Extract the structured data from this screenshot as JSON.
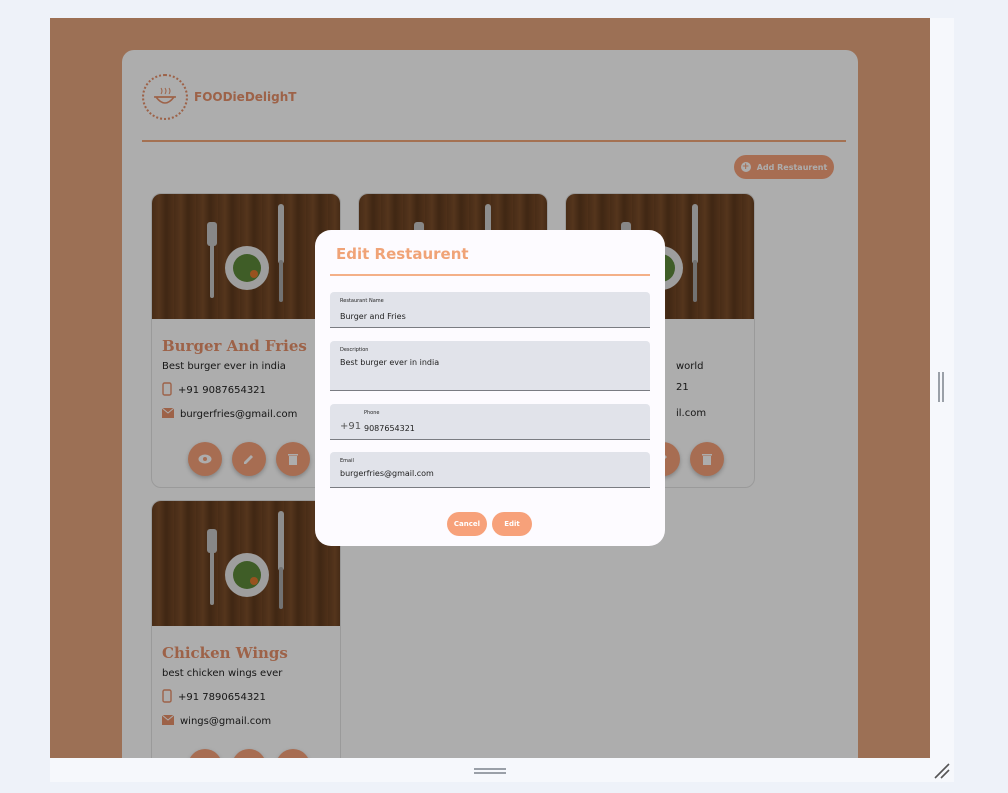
{
  "brand": {
    "name": "FOODieDelighT",
    "logo_text": "FOODieDelighT"
  },
  "toolbar": {
    "add_label": "Add Restaurent"
  },
  "restaurants": [
    {
      "name": "Burger And Fries",
      "description": "Best burger ever in india",
      "phone": "+91 9087654321",
      "email": "burgerfries@gmail.com"
    },
    {
      "name": "",
      "description": "",
      "phone": "",
      "email": ""
    },
    {
      "name": "",
      "description": "world",
      "phone": "21",
      "email": "il.com"
    },
    {
      "name": "Chicken Wings",
      "description": "best chicken wings ever",
      "phone": "+91 7890654321",
      "email": "wings@gmail.com"
    }
  ],
  "modal": {
    "title": "Edit Restaurent",
    "fields": {
      "name": {
        "label": "Restaurant Name",
        "value": "Burger and Fries"
      },
      "description": {
        "label": "Description",
        "value": "Best burger ever in india"
      },
      "phone": {
        "label": "Phone",
        "prefix": "+91",
        "value": "9087654321"
      },
      "email": {
        "label": "Email",
        "value": "burgerfries@gmail.com"
      }
    },
    "cancel_label": "Cancel",
    "edit_label": "Edit"
  },
  "colors": {
    "accent": "#f7a17a",
    "background": "#e6a57e",
    "overlay": "rgba(0,0,0,0.32)"
  },
  "icons": [
    "eye-icon",
    "pencil-icon",
    "trash-icon",
    "phone-icon",
    "mail-icon",
    "plus-circle-icon",
    "fork-icon",
    "knife-icon",
    "salad-bowl-icon"
  ]
}
